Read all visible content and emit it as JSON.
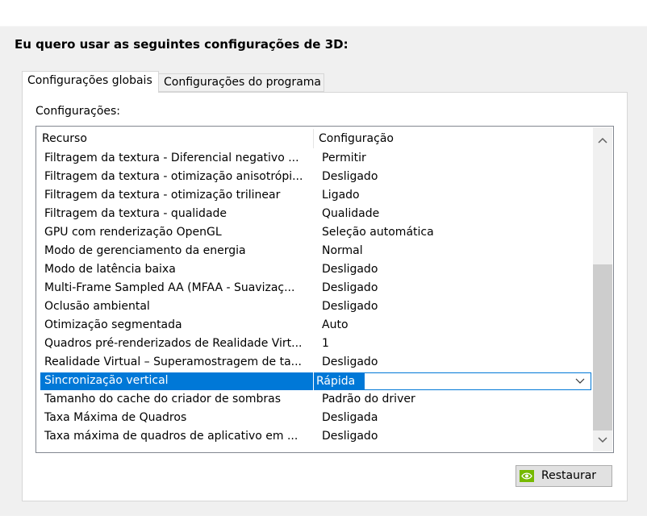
{
  "heading": "Eu quero usar as seguintes configurações de 3D:",
  "tabs": [
    {
      "label": "Configurações globais",
      "active": true
    },
    {
      "label": "Configurações do programa",
      "active": false
    }
  ],
  "section_label": "Configurações:",
  "table": {
    "columns": [
      "Recurso",
      "Configuração"
    ],
    "rows": [
      {
        "feature": "Filtragem da textura - Diferencial negativo ...",
        "setting": "Permitir"
      },
      {
        "feature": "Filtragem da textura - otimização anisotrópi...",
        "setting": "Desligado"
      },
      {
        "feature": "Filtragem da textura - otimização trilinear",
        "setting": "Ligado"
      },
      {
        "feature": "Filtragem da textura - qualidade",
        "setting": "Qualidade"
      },
      {
        "feature": "GPU com renderização OpenGL",
        "setting": "Seleção automática"
      },
      {
        "feature": "Modo de gerenciamento da energia",
        "setting": "Normal"
      },
      {
        "feature": "Modo de latência baixa",
        "setting": "Desligado"
      },
      {
        "feature": "Multi-Frame Sampled AA (MFAA - Suavizaç...",
        "setting": "Desligado"
      },
      {
        "feature": "Oclusão ambiental",
        "setting": "Desligado"
      },
      {
        "feature": "Otimização segmentada",
        "setting": "Auto"
      },
      {
        "feature": "Quadros pré-renderizados de Realidade Virt...",
        "setting": "1"
      },
      {
        "feature": "Realidade Virtual – Superamostragem de ta...",
        "setting": "Desligado"
      },
      {
        "feature": "Sincronização vertical",
        "setting": "Rápida",
        "selected": true
      },
      {
        "feature": "Tamanho do cache do criador de sombras",
        "setting": "Padrão do driver"
      },
      {
        "feature": "Taxa Máxima de Quadros",
        "setting": "Desligada"
      },
      {
        "feature": "Taxa máxima de quadros de aplicativo em ...",
        "setting": "Desligado"
      }
    ]
  },
  "restore_button": {
    "label": "Restaurar",
    "icon": "nvidia-logo-icon"
  },
  "colors": {
    "selection": "#0078d7",
    "panel": "#f0f0f0",
    "nvidia_green": "#76b900"
  }
}
